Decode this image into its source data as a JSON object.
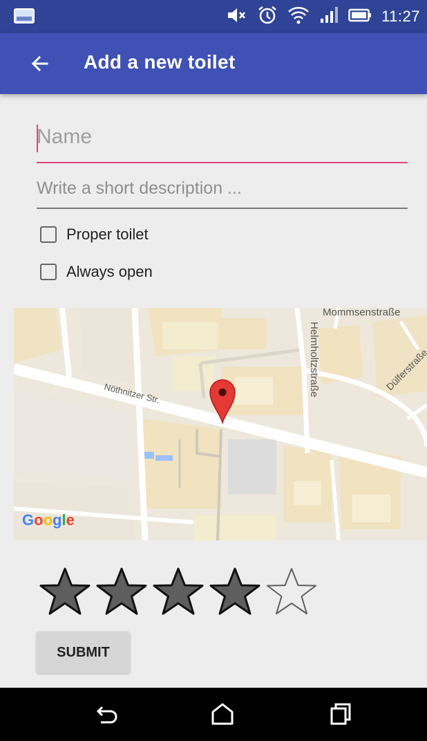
{
  "status_bar": {
    "time": "11:27",
    "icons": [
      "notification-icon",
      "mute-icon",
      "alarm-icon",
      "wifi-icon",
      "signal-icon",
      "battery-icon"
    ]
  },
  "app_bar": {
    "title": "Add a new toilet",
    "back_icon": "arrow-back-icon"
  },
  "form": {
    "name": {
      "placeholder": "Name",
      "value": ""
    },
    "description": {
      "placeholder": "Write a short description ...",
      "value": ""
    },
    "checkboxes": [
      {
        "label": "Proper toilet",
        "checked": false
      },
      {
        "label": "Always open",
        "checked": false
      }
    ]
  },
  "map": {
    "street_labels": [
      "Mommsenstraße",
      "Helmholtzstraße",
      "Dülferstraße",
      "Nöthnitzer Str."
    ],
    "logo": "Google",
    "marker_icon": "map-pin-icon"
  },
  "rating": {
    "value": 4,
    "max": 5
  },
  "submit": {
    "label": "SUBMIT"
  },
  "nav_bar": {
    "icons": [
      "back-icon",
      "home-icon",
      "recents-icon"
    ]
  },
  "colors": {
    "primary": "#3f51b5",
    "primary_dark": "#2f4397",
    "accent": "#e0457f",
    "map_pin": "#e53935"
  }
}
